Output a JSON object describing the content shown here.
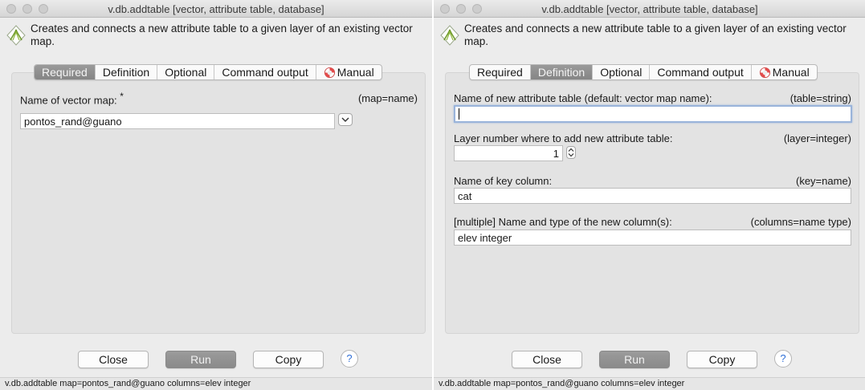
{
  "windows": [
    {
      "title": "v.db.addtable [vector, attribute table, database]",
      "description_line1": "Creates and connects a new attribute table to a given layer of an existing vector",
      "description_line2": "map.",
      "active_tab": "Required",
      "status": "v.db.addtable map=pontos_rand@guano columns=elev integer"
    },
    {
      "title": "v.db.addtable [vector, attribute table, database]",
      "description_line1": "Creates and connects a new attribute table to a given layer of an existing vector",
      "description_line2": "map.",
      "active_tab": "Definition",
      "status": "v.db.addtable map=pontos_rand@guano columns=elev integer"
    }
  ],
  "tabs": {
    "required": "Required",
    "definition": "Definition",
    "optional": "Optional",
    "command_output": "Command output",
    "manual": "Manual"
  },
  "required_tab": {
    "map_label": "Name of vector map:",
    "required_marker": "*",
    "map_param": "(map=name)",
    "map_value": "pontos_rand@guano"
  },
  "definition_tab": {
    "table_label": "Name of new attribute table (default: vector map name):",
    "table_param": "(table=string)",
    "table_value": "",
    "layer_label": "Layer number where to add new attribute table:",
    "layer_param": "(layer=integer)",
    "layer_value": "1",
    "key_label": "Name of key column:",
    "key_param": "(key=name)",
    "key_value": "cat",
    "columns_label": "[multiple] Name and type of the new column(s):",
    "columns_param": "(columns=name type)",
    "columns_value": "elev integer"
  },
  "buttons": {
    "close": "Close",
    "run": "Run",
    "copy": "Copy",
    "help": "?"
  },
  "colors": {
    "window_bg": "#ececec",
    "panel_bg": "#e3e3e3",
    "active_tab": "#8f8f8f",
    "help_blue": "#2f6fd6"
  }
}
